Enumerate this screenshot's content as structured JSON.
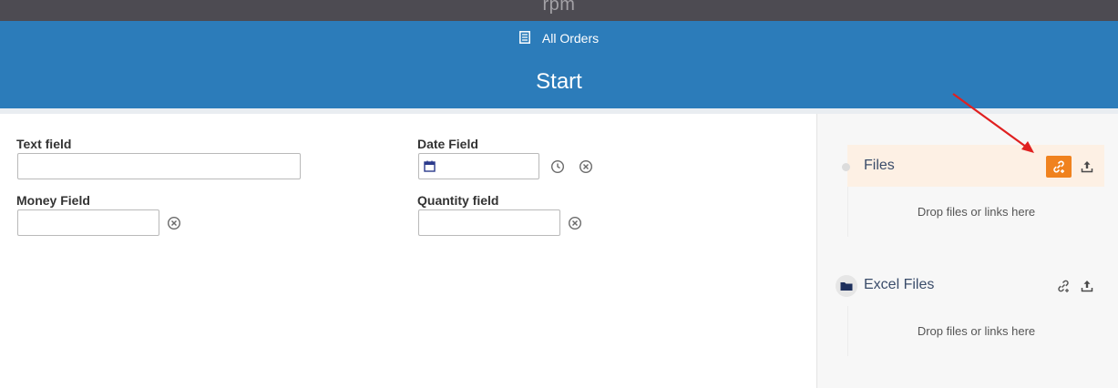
{
  "app": {
    "brand": "rpm"
  },
  "header": {
    "breadcrumb_label": "All Orders",
    "breadcrumb_icon": "document-icon",
    "title": "Start",
    "color": "#2c7cba"
  },
  "form": {
    "text_field": {
      "label": "Text field",
      "value": ""
    },
    "date_field": {
      "label": "Date Field",
      "value": ""
    },
    "money_field": {
      "label": "Money Field",
      "value": ""
    },
    "quantity_field": {
      "label": "Quantity field",
      "value": ""
    }
  },
  "sidebar": {
    "sections": [
      {
        "title": "Files",
        "drop_text": "Drop files or links here",
        "highlighted": true,
        "accent": "#f0821e"
      },
      {
        "title": "Excel Files",
        "drop_text": "Drop files or links here",
        "highlighted": false
      }
    ]
  },
  "annotation": {
    "arrow_color": "#e02020"
  }
}
